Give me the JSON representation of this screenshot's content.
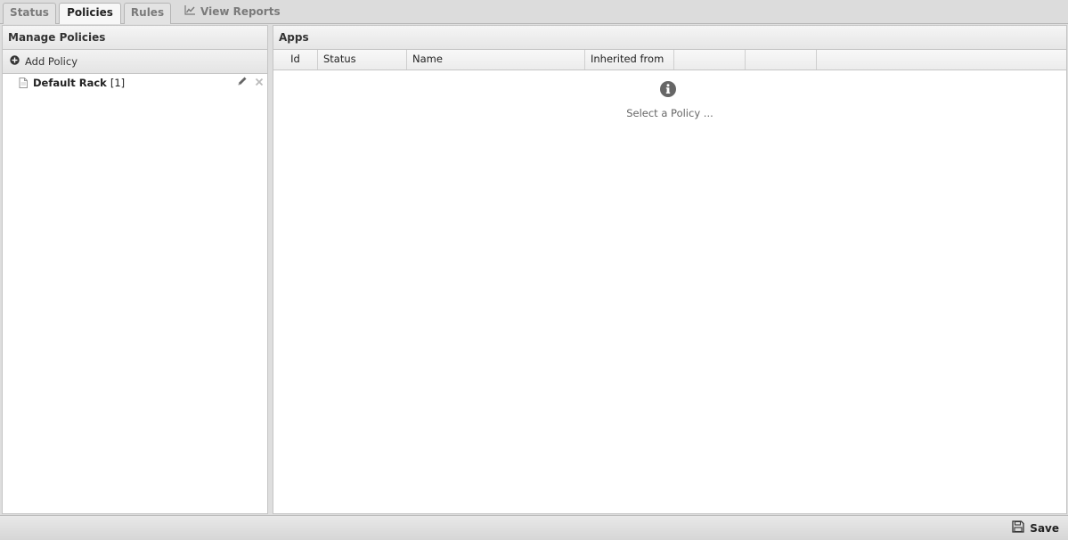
{
  "tabs": [
    {
      "label": "Status"
    },
    {
      "label": "Policies"
    },
    {
      "label": "Rules"
    }
  ],
  "view_reports_label": "View Reports",
  "left_panel": {
    "title": "Manage Policies",
    "add_label": "Add Policy",
    "policies": [
      {
        "name": "Default Rack",
        "count": "[1]"
      }
    ]
  },
  "right_panel": {
    "title": "Apps",
    "columns": [
      "Id",
      "Status",
      "Name",
      "Inherited from",
      "",
      "",
      ""
    ],
    "empty_message": "Select a Policy ..."
  },
  "footer": {
    "save_label": "Save"
  },
  "icons": {
    "reports": "line-chart-icon",
    "add": "plus-circle-icon",
    "policy": "document-icon",
    "edit": "pencil-icon",
    "delete": "close-icon",
    "info": "info-circle-icon",
    "save": "floppy-disk-icon"
  }
}
